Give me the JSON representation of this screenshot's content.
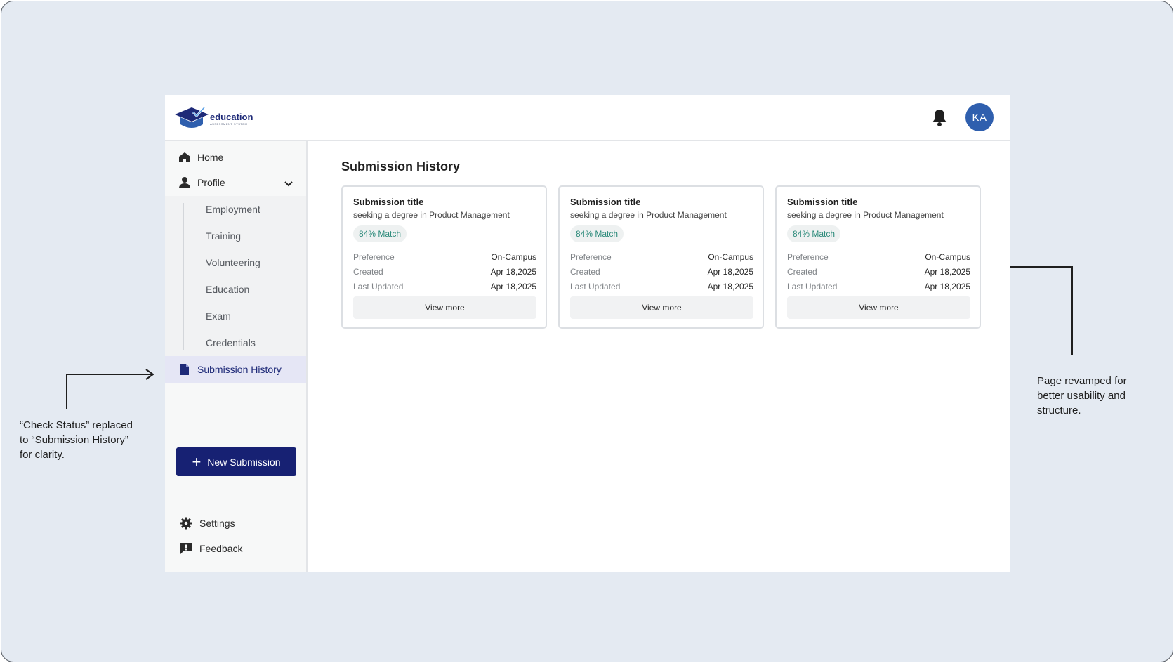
{
  "app": {
    "logo_word": "education",
    "logo_sub": "ASSESSMENT SYSTEM",
    "avatar_initials": "KA",
    "icons": {
      "notifications": "bell-icon",
      "logo": "graduation-cap-icon"
    }
  },
  "sidebar": {
    "home": "Home",
    "profile": "Profile",
    "profile_sub": [
      "Employment",
      "Training",
      "Volunteering",
      "Education",
      "Exam",
      "Credentials"
    ],
    "submission_history": "Submission History",
    "new_submission": "New Submission",
    "settings": "Settings",
    "feedback": "Feedback"
  },
  "main": {
    "title": "Submission History",
    "cards": [
      {
        "title": "Submission title",
        "subtitle": "seeking a degree in Product Management",
        "match": "84% Match",
        "rows": [
          {
            "k": "Preference",
            "v": "On-Campus"
          },
          {
            "k": "Created",
            "v": "Apr 18,2025"
          },
          {
            "k": "Last Updated",
            "v": "Apr 18,2025"
          }
        ],
        "button": "View more"
      },
      {
        "title": "Submission title",
        "subtitle": "seeking a degree in Product Management",
        "match": "84% Match",
        "rows": [
          {
            "k": "Preference",
            "v": "On-Campus"
          },
          {
            "k": "Created",
            "v": "Apr 18,2025"
          },
          {
            "k": "Last Updated",
            "v": "Apr 18,2025"
          }
        ],
        "button": "View more"
      },
      {
        "title": "Submission title",
        "subtitle": "seeking a degree in Product Management",
        "match": "84% Match",
        "rows": [
          {
            "k": "Preference",
            "v": "On-Campus"
          },
          {
            "k": "Created",
            "v": "Apr 18,2025"
          },
          {
            "k": "Last Updated",
            "v": "Apr 18,2025"
          }
        ],
        "button": "View more"
      }
    ]
  },
  "annotations": {
    "left_lines": [
      "“Check Status” replaced",
      "to “Submission History”",
      "for clarity."
    ],
    "right_lines": [
      "Page revamped for",
      "better usability and",
      "structure."
    ]
  },
  "colors": {
    "brand_navy": "#172173",
    "avatar_blue": "#2f5fae",
    "match_green": "#2b8a7a",
    "canvas_bg": "#e4eaf2"
  }
}
